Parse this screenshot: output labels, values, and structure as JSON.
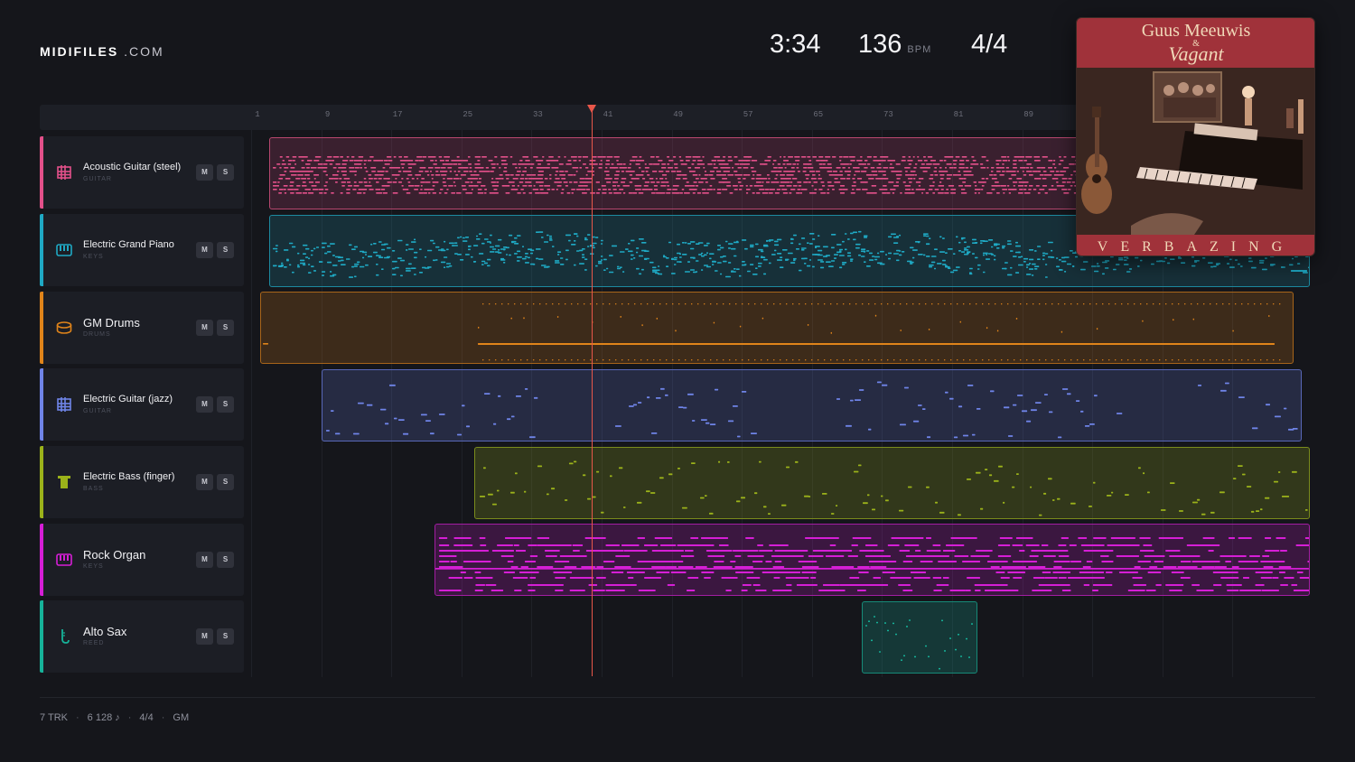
{
  "brand": {
    "bold": "MIDIFILES",
    "light": ".COM"
  },
  "transport": {
    "time": "3:34",
    "bpm": "136",
    "bpm_unit": "BPM",
    "signature": "4/4"
  },
  "ruler": {
    "ticks": [
      "1",
      "9",
      "17",
      "25",
      "33",
      "41",
      "49",
      "57",
      "65",
      "73",
      "81",
      "89"
    ]
  },
  "playhead": {
    "bar": 38
  },
  "tracks": [
    {
      "name": "Acoustic Guitar (steel)",
      "category": "GUITAR",
      "icon": "guitar-grid-icon",
      "color": "#e3508a",
      "mute": "M",
      "solo": "S"
    },
    {
      "name": "Electric Grand Piano",
      "category": "KEYS",
      "icon": "keyboard-icon",
      "color": "#1fa9c4",
      "mute": "M",
      "solo": "S"
    },
    {
      "name": "GM Drums",
      "category": "DRUMS",
      "icon": "drum-icon",
      "color": "#e0841a",
      "mute": "M",
      "solo": "S"
    },
    {
      "name": "Electric Guitar (jazz)",
      "category": "GUITAR",
      "icon": "guitar-grid-icon",
      "color": "#6f84e8",
      "mute": "M",
      "solo": "S"
    },
    {
      "name": "Electric Bass (finger)",
      "category": "BASS",
      "icon": "bass-icon",
      "color": "#9bb21a",
      "mute": "M",
      "solo": "S"
    },
    {
      "name": "Rock Organ",
      "category": "KEYS",
      "icon": "organ-icon",
      "color": "#d61ed6",
      "mute": "M",
      "solo": "S"
    },
    {
      "name": "Alto Sax",
      "category": "REED",
      "icon": "sax-icon",
      "color": "#16b39a",
      "mute": "M",
      "solo": "S"
    }
  ],
  "album": {
    "artist": "Guus Meeuwis",
    "amp": "&",
    "band": "Vagant",
    "title": "VERBAZING"
  },
  "footer": {
    "tracks": "7 TRK",
    "notes": "6 128 ♪",
    "signature": "4/4",
    "standard": "GM"
  }
}
